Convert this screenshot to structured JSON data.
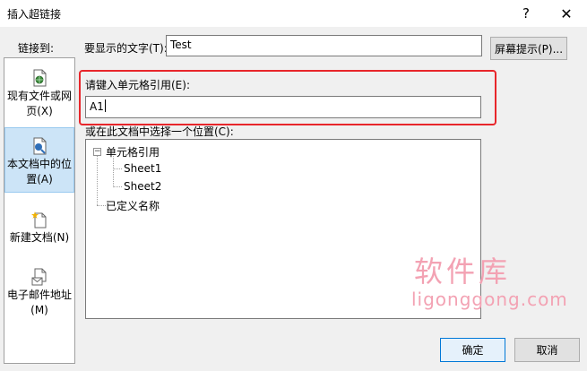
{
  "window": {
    "title": "插入超链接",
    "help": "?",
    "close": "✕"
  },
  "sidebar": {
    "label": "链接到:",
    "items": [
      {
        "line1": "现有文件或网",
        "line2": "页(X)",
        "icon": "existing-file-icon",
        "selected": false
      },
      {
        "line1": "本文档中的位",
        "line2": "置(A)",
        "icon": "place-in-document-icon",
        "selected": true
      },
      {
        "line1": "新建文档(N)",
        "line2": "",
        "icon": "new-document-icon",
        "selected": false
      },
      {
        "line1": "电子邮件地址",
        "line2": "(M)",
        "icon": "email-address-icon",
        "selected": false
      }
    ]
  },
  "display_text": {
    "label": "要显示的文字(T):",
    "value": "Test"
  },
  "screentip_button": "屏幕提示(P)...",
  "cell_reference": {
    "label": "请键入单元格引用(E):",
    "value": "A1"
  },
  "location": {
    "label": "或在此文档中选择一个位置(C):",
    "tree": {
      "root": "单元格引用",
      "root_toggle": "−",
      "children": [
        "Sheet1",
        "Sheet2"
      ],
      "defined_names": "已定义名称"
    }
  },
  "watermark": {
    "line1": "软件库",
    "line2": "ligonggong.com"
  },
  "buttons": {
    "ok": "确定",
    "cancel": "取消"
  },
  "colors": {
    "highlight_border": "#e8262b",
    "watermark": "#f3a2b3",
    "selected_bg": "#cce4f7"
  }
}
